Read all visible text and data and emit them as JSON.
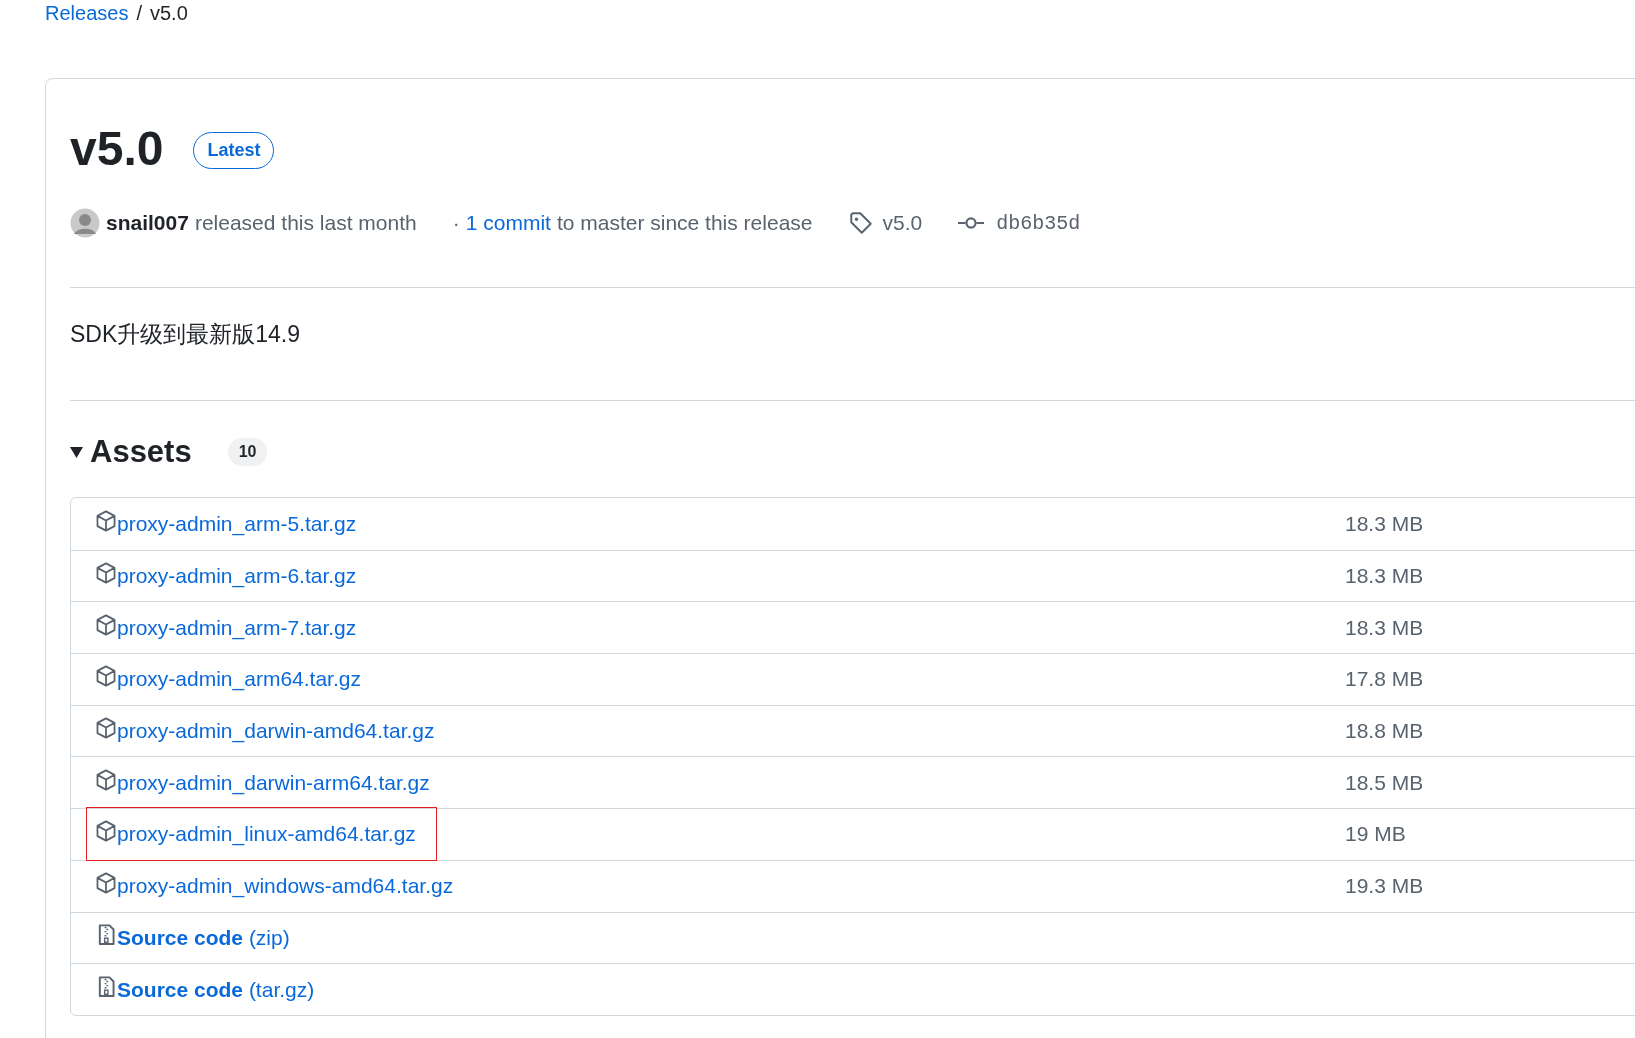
{
  "breadcrumb": {
    "link": "Releases",
    "separator": "/",
    "current": "v5.0"
  },
  "release": {
    "title": "v5.0",
    "badge": "Latest",
    "author": "snail007",
    "released": "released this last month",
    "commits_prefix": "·",
    "commits_link": "1 commit",
    "commits_text": "to master since this release",
    "tag": "v5.0",
    "commit": "db6b35d",
    "description": "SDK升级到最新版14.9"
  },
  "assets": {
    "title": "Assets",
    "expanded": true,
    "count": "10",
    "items": [
      {
        "kind": "package",
        "name": "proxy-admin_arm-5.tar.gz",
        "size": "18.3 MB",
        "highlighted": false
      },
      {
        "kind": "package",
        "name": "proxy-admin_arm-6.tar.gz",
        "size": "18.3 MB",
        "highlighted": false
      },
      {
        "kind": "package",
        "name": "proxy-admin_arm-7.tar.gz",
        "size": "18.3 MB",
        "highlighted": false
      },
      {
        "kind": "package",
        "name": "proxy-admin_arm64.tar.gz",
        "size": "17.8 MB",
        "highlighted": false
      },
      {
        "kind": "package",
        "name": "proxy-admin_darwin-amd64.tar.gz",
        "size": "18.8 MB",
        "highlighted": false
      },
      {
        "kind": "package",
        "name": "proxy-admin_darwin-arm64.tar.gz",
        "size": "18.5 MB",
        "highlighted": false
      },
      {
        "kind": "package",
        "name": "proxy-admin_linux-amd64.tar.gz",
        "size": "19 MB",
        "highlighted": true
      },
      {
        "kind": "package",
        "name": "proxy-admin_windows-amd64.tar.gz",
        "size": "19.3 MB",
        "highlighted": false
      },
      {
        "kind": "source",
        "name": "**Source code** (zip)",
        "highlighted": false
      },
      {
        "kind": "source",
        "name": "**Source code** (tar.gz)",
        "highlighted": false
      }
    ]
  }
}
